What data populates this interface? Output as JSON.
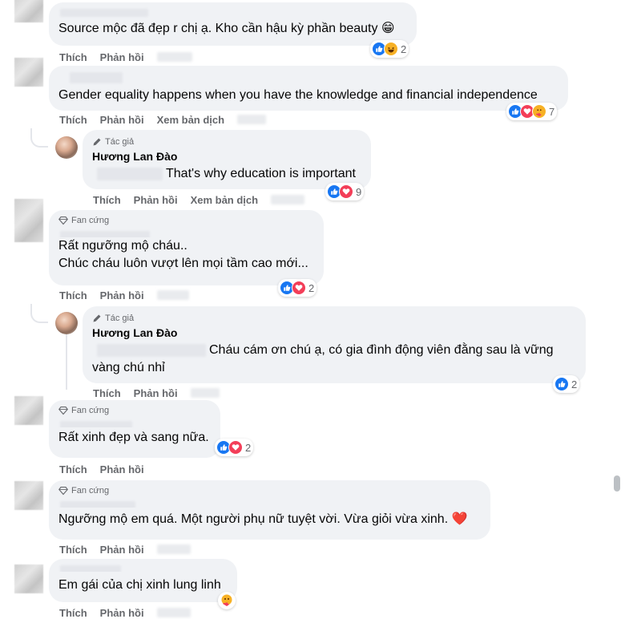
{
  "actions": {
    "like": "Thích",
    "reply": "Phản hồi",
    "translate": "Xem bản dịch"
  },
  "badges": {
    "author": "Tác giả",
    "fan": "Fan cứng"
  },
  "comments": [
    {
      "text": "Source mộc đã đẹp r chị ạ. Kho cần hậu kỳ phần beauty 😁",
      "reactions": [
        "like",
        "haha"
      ],
      "count": "2"
    },
    {
      "text": "Gender equality happens when you have the knowledge and financial independence",
      "reactions": [
        "like",
        "love",
        "care"
      ],
      "count": "7"
    },
    {
      "author": "Hương Lan Đào",
      "badge": "Tác giả",
      "text": "That's why education is important",
      "reactions": [
        "like",
        "love"
      ],
      "count": "9"
    },
    {
      "badge": "Fan cứng",
      "line1": "Rất ngưỡng mộ cháu..",
      "line2": "Chúc cháu luôn vượt lên mọi tầm cao mới...",
      "reactions": [
        "like",
        "love"
      ],
      "count": "2"
    },
    {
      "author": "Hương Lan Đào",
      "badge": "Tác giả",
      "line1": "Cháu cám ơn chú ạ, có gia đình động viên đằng sau là vững",
      "line2": "vàng chú nhỉ",
      "reactions": [
        "like"
      ],
      "count": "2"
    },
    {
      "badge": "Fan cứng",
      "text": "Rất xinh đẹp và sang nữa.",
      "reactions": [
        "like",
        "love"
      ],
      "count": "2"
    },
    {
      "badge": "Fan cứng",
      "text": "Ngưỡng mộ em quá. Một người phụ nữ tuyệt vời. Vừa giỏi vừa xinh. ❤️"
    },
    {
      "text": "Em gái của chị xinh lung linh"
    }
  ],
  "colors": {
    "bubble": "#f0f2f5",
    "action_text": "#65676b",
    "like": "#1877f2",
    "love": "#f33e58",
    "haha": "#f7b125"
  }
}
